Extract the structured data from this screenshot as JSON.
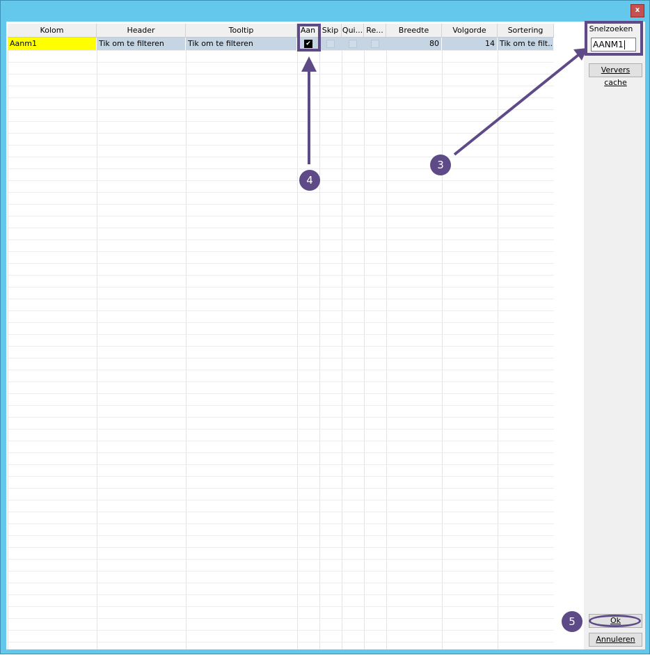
{
  "window": {
    "close_glyph": "x",
    "background": "#64c8ec",
    "accent": "#5e4a86"
  },
  "grid": {
    "columns": [
      {
        "label": "Kolom"
      },
      {
        "label": "Header"
      },
      {
        "label": "Tooltip"
      },
      {
        "label": "Aan"
      },
      {
        "label": "Skip"
      },
      {
        "label": "Qui..."
      },
      {
        "label": "Re..."
      },
      {
        "label": "Breedte"
      },
      {
        "label": "Volgorde"
      },
      {
        "label": "Sortering"
      }
    ],
    "row": {
      "kolom": "Aanm1",
      "header": "Tik om te filteren",
      "tooltip": "Tik om te filteren",
      "aan_checked": true,
      "skip_checked": false,
      "qui_checked": false,
      "re_checked": false,
      "breedte": "80",
      "volgorde": "14",
      "sortering": "Tik om te filt..."
    },
    "selected_row_color": "#c6d5e3",
    "kolom_highlight_color": "#ffff00"
  },
  "side": {
    "snelzoeken_label": "Snelzoeken",
    "snelzoeken_value": "AANM1",
    "ververs_label": "Ververs cache",
    "ok_label": "Ok",
    "annuleren_label": "Annuleren"
  },
  "annotations": {
    "badge_3": "3",
    "badge_4": "4",
    "badge_5": "5"
  }
}
